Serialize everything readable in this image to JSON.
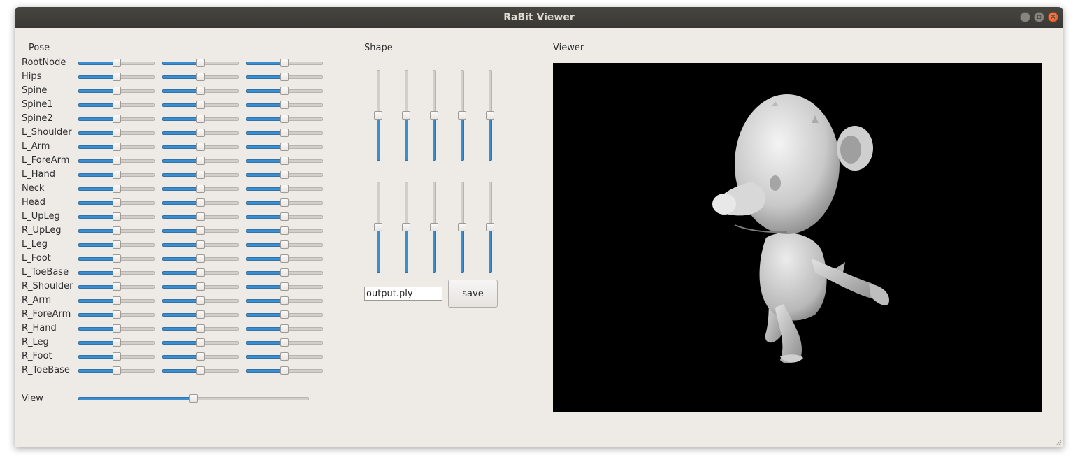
{
  "window": {
    "title": "RaBit Viewer"
  },
  "pose": {
    "label": "Pose",
    "joints": [
      "RootNode",
      "Hips",
      "Spine",
      "Spine1",
      "Spine2",
      "L_Shoulder",
      "L_Arm",
      "L_ForeArm",
      "L_Hand",
      "Neck",
      "Head",
      "L_UpLeg",
      "R_UpLeg",
      "L_Leg",
      "L_Foot",
      "L_ToeBase",
      "R_Shoulder",
      "R_Arm",
      "R_ForeArm",
      "R_Hand",
      "R_Leg",
      "R_Foot",
      "R_ToeBase"
    ],
    "slider_value_fraction": 0.5
  },
  "view": {
    "label": "View",
    "value_fraction": 0.5
  },
  "shape": {
    "label": "Shape",
    "slider_rows": 2,
    "sliders_per_row": 5,
    "value_fraction": 0.5
  },
  "output": {
    "filename": "output.ply",
    "save_label": "save"
  },
  "viewer": {
    "label": "Viewer",
    "background": "#000000",
    "model": "white bear character mesh"
  },
  "colors": {
    "accent": "#3b8fd0",
    "window_bg": "#eeebe7",
    "titlebar": "#3f3e3a",
    "close": "#e8612c"
  }
}
